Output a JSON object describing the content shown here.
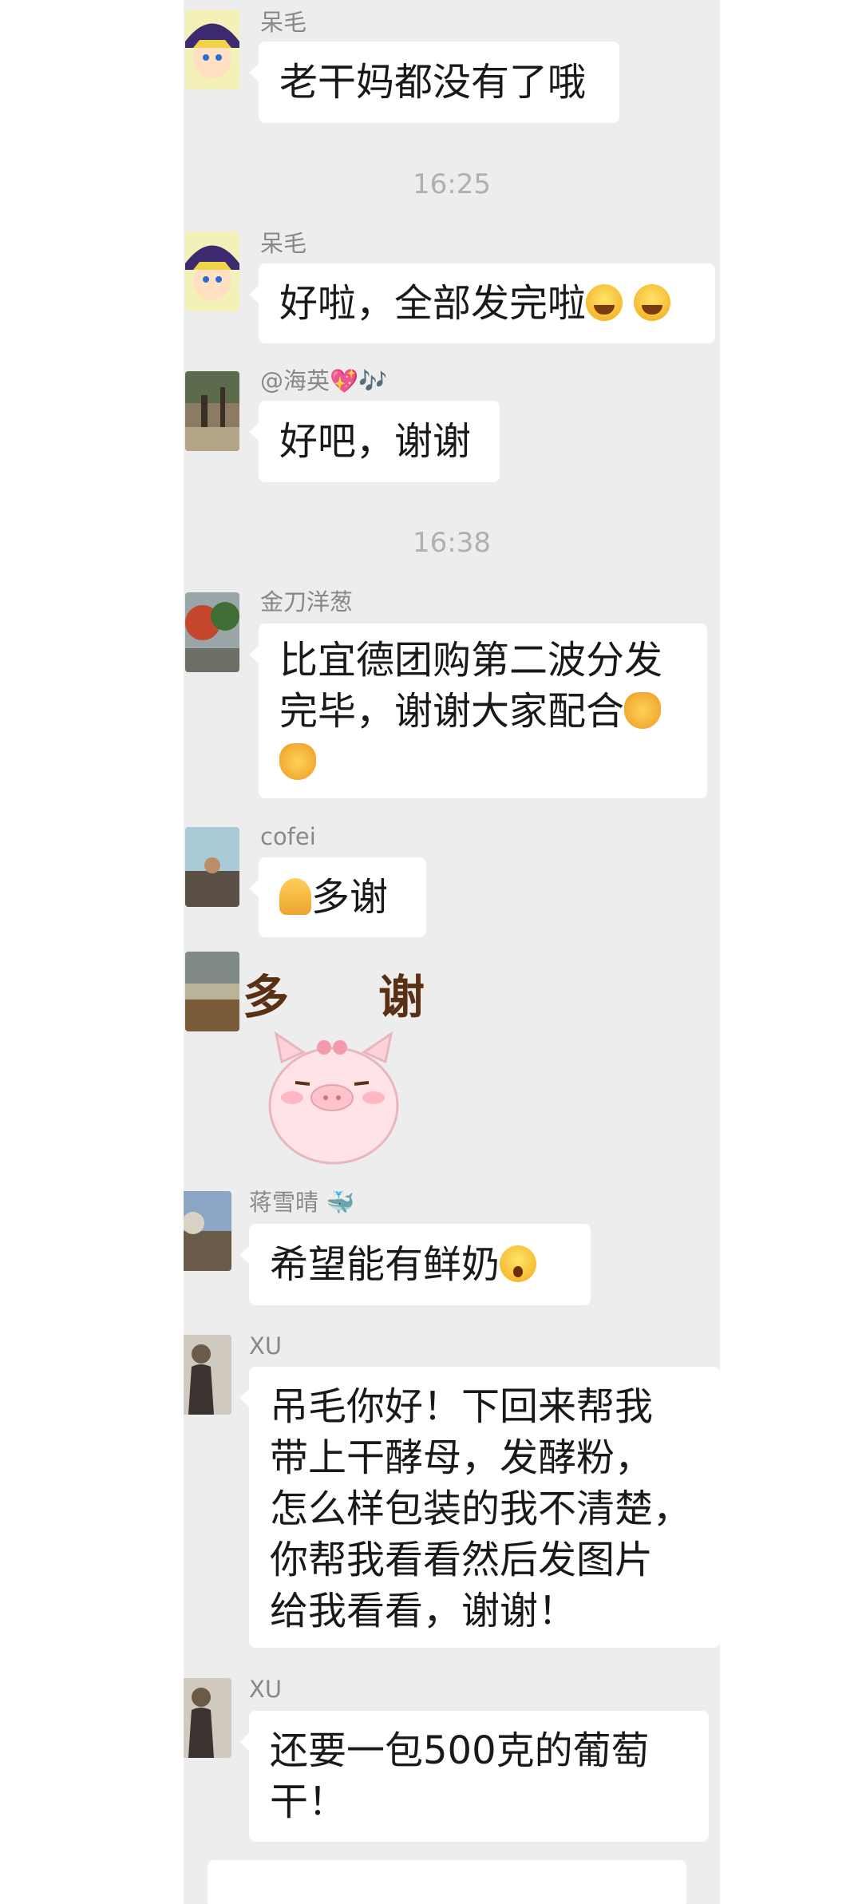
{
  "messages": [
    {
      "sender": "呆毛",
      "text": "老干妈都没有了哦"
    },
    {
      "time": "16:25"
    },
    {
      "sender": "呆毛",
      "text": "好啦，全部发完啦",
      "emoji": [
        "grinning-face",
        "grinning-face"
      ]
    },
    {
      "sender": "@海英💖🎶",
      "text": "好吧，谢谢"
    },
    {
      "time": "16:38"
    },
    {
      "sender": "金刀洋葱",
      "text_lines": [
        "比宜德团购第二波分发",
        "完毕，谢谢大家配合"
      ],
      "emoji": [
        "handshake",
        "handshake"
      ]
    },
    {
      "sender": "cofei",
      "text": "多谢",
      "emoji": [
        "folded-hands"
      ]
    },
    {
      "sticker_caption": [
        "多",
        "谢"
      ],
      "sticker": "pink-pig"
    },
    {
      "sender": "蒋雪晴 🐳",
      "text": "希望能有鲜奶",
      "emoji": [
        "astonished-face"
      ]
    },
    {
      "sender": "XU",
      "text_lines": [
        "吊毛你好！下回来帮我",
        "带上干酵母，发酵粉，",
        "怎么样包装的我不清楚，",
        "你帮我看看然后发图片",
        "给我看看，谢谢！"
      ]
    },
    {
      "sender": "XU",
      "text_lines": [
        "还要一包500克的葡萄",
        "干！"
      ]
    }
  ],
  "colors": {
    "chat_bg": "#ededed",
    "bubble": "#ffffff",
    "name": "#888888",
    "time": "#b0b0b0"
  }
}
